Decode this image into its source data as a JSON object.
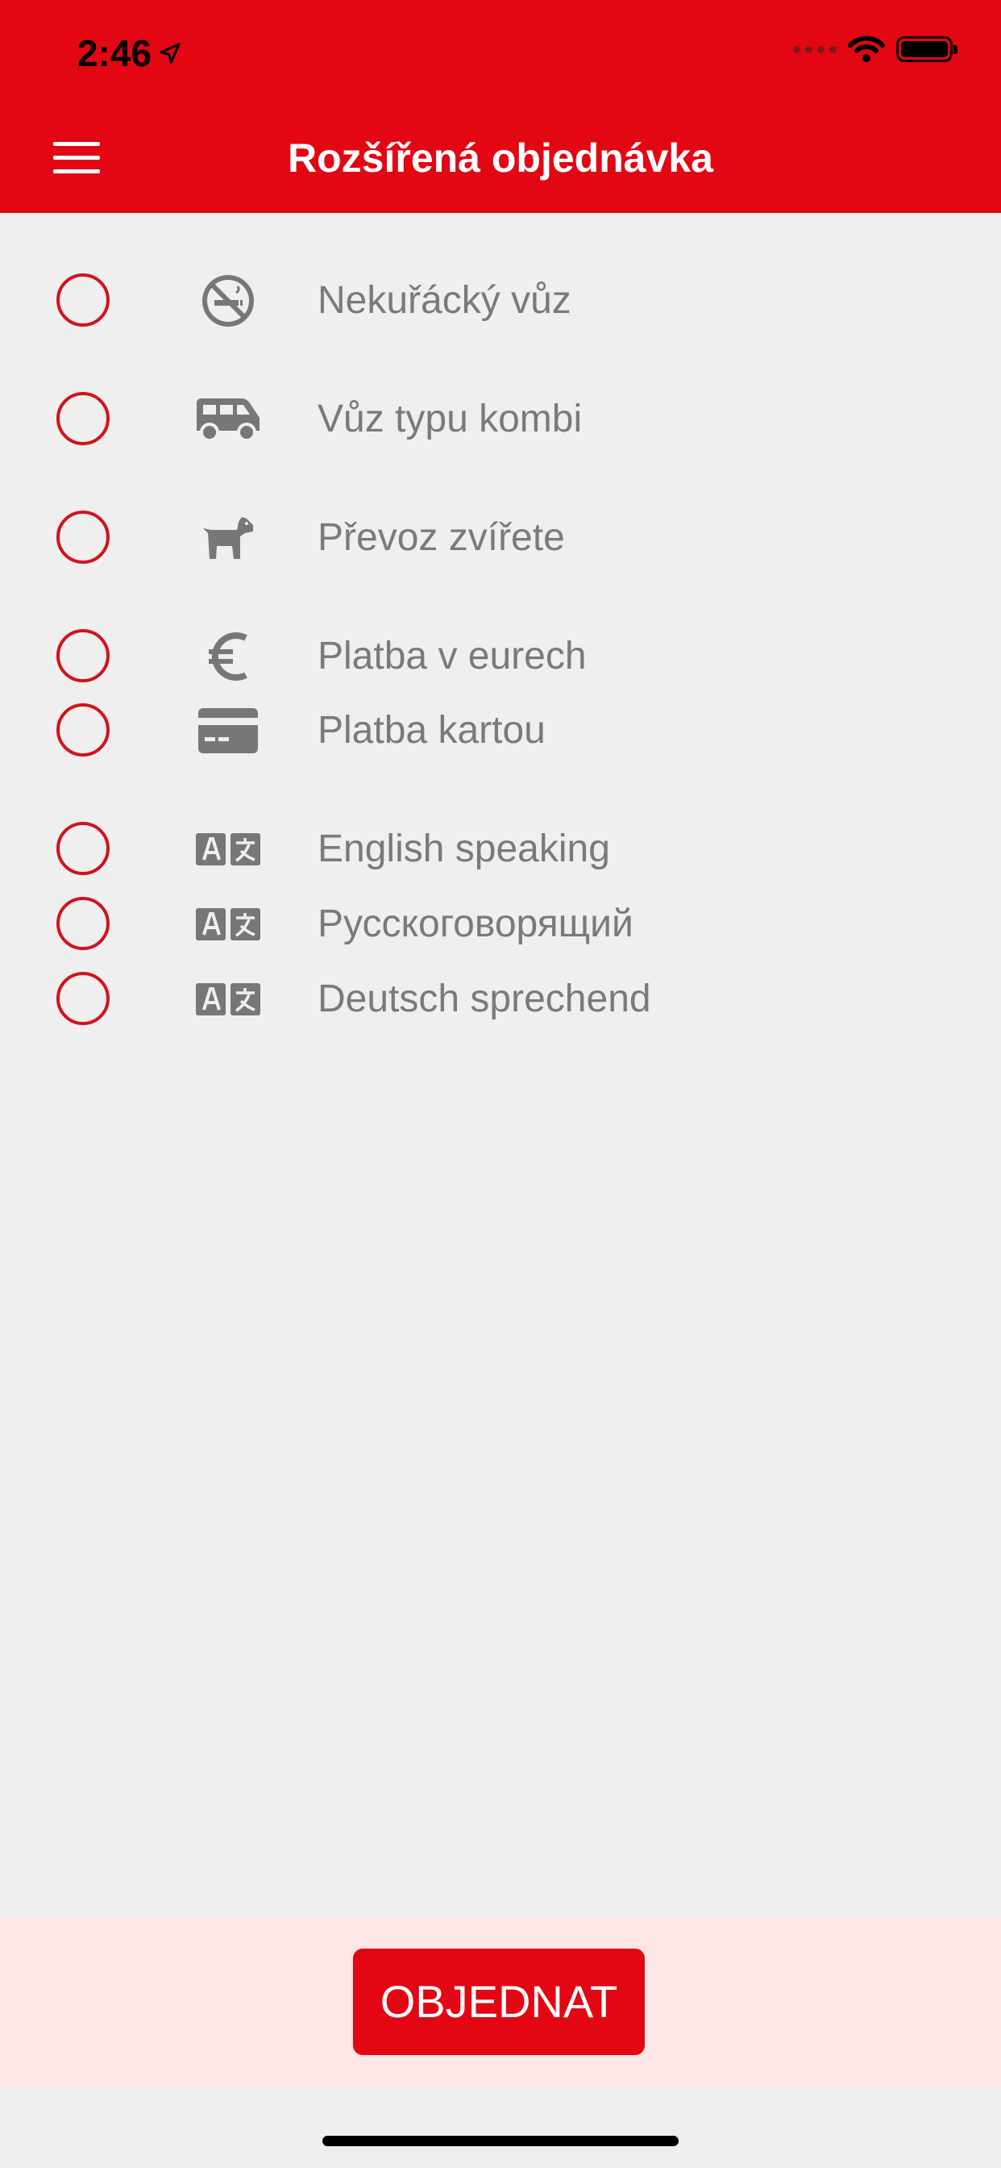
{
  "status_bar": {
    "time": "2:46"
  },
  "header": {
    "title": "Rozšířená objednávka"
  },
  "options": [
    {
      "label": "Nekuřácký vůz",
      "icon": "no-smoking-icon",
      "selected": false
    },
    {
      "label": "Vůz typu kombi",
      "icon": "van-icon",
      "selected": false
    },
    {
      "label": "Převoz zvířete",
      "icon": "dog-icon",
      "selected": false
    },
    {
      "label": "Platba v eurech",
      "icon": "euro-icon",
      "selected": false
    },
    {
      "label": "Platba kartou",
      "icon": "credit-card-icon",
      "selected": false
    },
    {
      "label": "English speaking",
      "icon": "translate-icon",
      "selected": false
    },
    {
      "label": "Русскоговорящий",
      "icon": "translate-icon",
      "selected": false
    },
    {
      "label": "Deutsch sprechend",
      "icon": "translate-icon",
      "selected": false
    }
  ],
  "footer": {
    "order_label": "OBJEDNAT"
  },
  "colors": {
    "accent": "#e30613",
    "label_gray": "#7a7a7a",
    "background": "#efefef",
    "footer_bg": "#fde6e6"
  }
}
